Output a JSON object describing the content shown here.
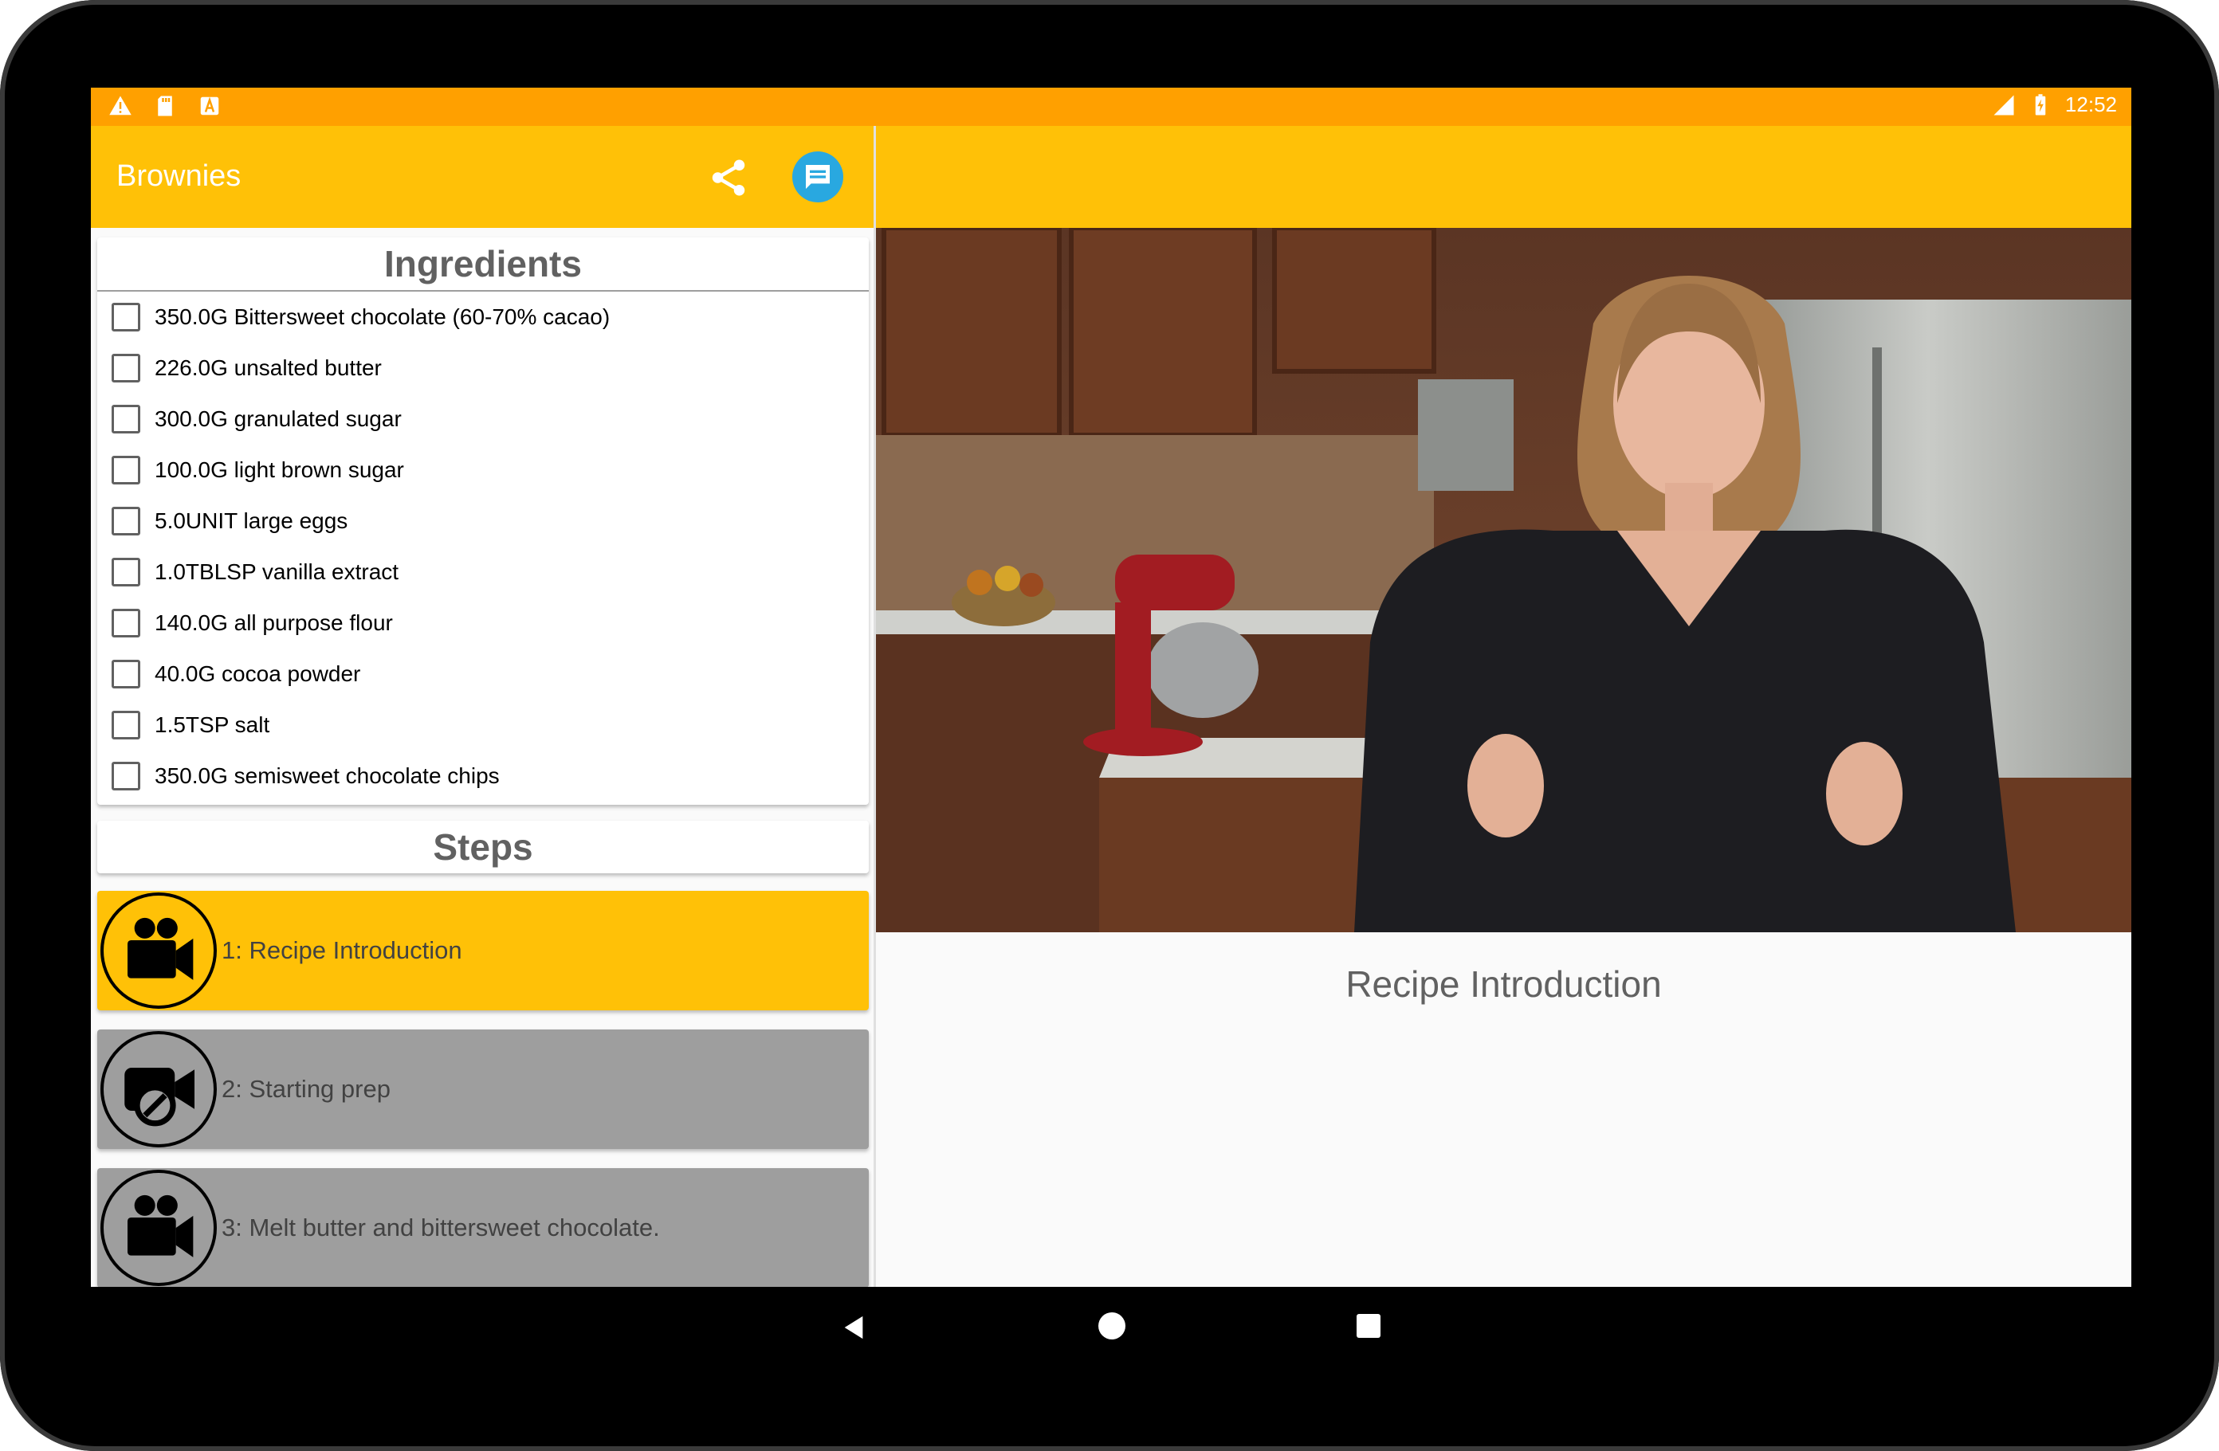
{
  "status_bar": {
    "time": "12:52",
    "network": "4G",
    "icons_left": [
      "warning-icon",
      "sd-card-icon",
      "text-a-icon"
    ],
    "icons_right": [
      "signal-icon",
      "battery-charging-icon"
    ]
  },
  "app_bar": {
    "title": "Brownies",
    "actions": [
      "share-icon",
      "message-icon"
    ]
  },
  "ingredients": {
    "header": "Ingredients",
    "items": [
      "350.0G Bittersweet chocolate (60-70% cacao)",
      "226.0G unsalted butter",
      "300.0G granulated sugar",
      "100.0G light brown sugar",
      "5.0UNIT large eggs",
      "1.0TBLSP vanilla extract",
      "140.0G all purpose flour",
      "40.0G cocoa powder",
      "1.5TSP salt",
      "350.0G semisweet chocolate chips"
    ]
  },
  "steps": {
    "header": "Steps",
    "items": [
      {
        "label": "1: Recipe Introduction",
        "icon": "video-camera-icon",
        "active": true
      },
      {
        "label": "2: Starting prep",
        "icon": "video-camera-off-icon",
        "active": false
      },
      {
        "label": "3: Melt butter and bittersweet chocolate.",
        "icon": "video-camera-icon",
        "active": false
      }
    ]
  },
  "detail": {
    "caption": "Recipe Introduction"
  },
  "colors": {
    "status_bar": "#ffa000",
    "app_bar": "#ffc107",
    "inactive_step": "#9e9e9e",
    "message_button": "#29a8e0"
  }
}
